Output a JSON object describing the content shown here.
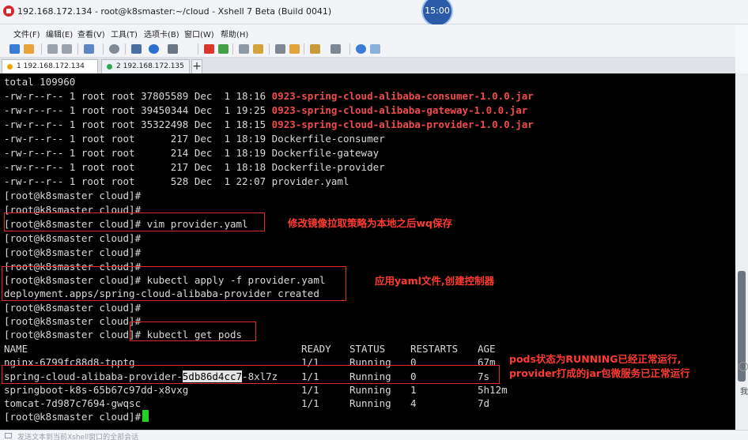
{
  "window": {
    "title": "192.168.172.134 - root@k8smaster:~/cloud - Xshell 7 Beta (Build 0041)",
    "clock": "15:00"
  },
  "menu": [
    "文件(F)",
    "编辑(E)",
    "查看(V)",
    "工具(T)",
    "选项卡(B)",
    "窗口(W)",
    "帮助(H)"
  ],
  "tabs": [
    {
      "label": "1 192.168.172.134",
      "dot_color": "#f0a500"
    },
    {
      "label": "2 192.168.172.135",
      "dot_color": "#2fa84f"
    }
  ],
  "tab_add": "+",
  "terminal": {
    "lines": [
      {
        "text": "total 109960"
      },
      {
        "text": "-rw-r--r-- 1 root root 37805589 Dec  1 18:16 ",
        "jar": "0923-spring-cloud-alibaba-consumer-1.0.0.jar"
      },
      {
        "text": "-rw-r--r-- 1 root root 39450344 Dec  1 19:25 ",
        "jar": "0923-spring-cloud-alibaba-gateway-1.0.0.jar"
      },
      {
        "text": "-rw-r--r-- 1 root root 35322498 Dec  1 18:15 ",
        "jar": "0923-spring-cloud-alibaba-provider-1.0.0.jar"
      },
      {
        "text": "-rw-r--r-- 1 root root      217 Dec  1 18:19 Dockerfile-consumer"
      },
      {
        "text": "-rw-r--r-- 1 root root      214 Dec  1 18:19 Dockerfile-gateway"
      },
      {
        "text": "-rw-r--r-- 1 root root      217 Dec  1 18:18 Dockerfile-provider"
      },
      {
        "text": "-rw-r--r-- 1 root root      528 Dec  1 22:07 provider.yaml"
      },
      {
        "text": "[root@k8smaster cloud]#"
      },
      {
        "text": "[root@k8smaster cloud]#"
      },
      {
        "text": "[root@k8smaster cloud]# vim provider.yaml"
      },
      {
        "text": "[root@k8smaster cloud]#"
      },
      {
        "text": "[root@k8smaster cloud]#"
      },
      {
        "text": "[root@k8smaster cloud]#"
      },
      {
        "text": "[root@k8smaster cloud]# kubectl apply -f provider.yaml"
      },
      {
        "text": "deployment.apps/spring-cloud-alibaba-provider created"
      },
      {
        "text": "[root@k8smaster cloud]#"
      },
      {
        "text": "[root@k8smaster cloud]#"
      },
      {
        "text": "[root@k8smaster cloud]# kubectl get pods"
      }
    ],
    "pods_header": [
      "NAME",
      "READY",
      "STATUS",
      "RESTARTS",
      "AGE"
    ],
    "pods": [
      [
        "nginx-6799fc88d8-tpptg",
        "1/1",
        "Running",
        "0",
        "67m"
      ],
      [
        "spring-cloud-alibaba-provider-5db86d4cc7-8xl7z",
        "1/1",
        "Running",
        "0",
        "7s"
      ],
      [
        "springboot-k8s-65b67c97dd-x8vxg",
        "1/1",
        "Running",
        "1",
        "5h12m"
      ],
      [
        "tomcat-7d987c7694-gwqsc",
        "1/1",
        "Running",
        "4",
        "7d"
      ]
    ],
    "provider_pod": {
      "prefix": "spring-cloud-alibaba-provider-",
      "hash": "5db86d4cc7",
      "suffix": "-8xl7z"
    },
    "final_prompt": "[root@k8smaster cloud]#"
  },
  "annotations": {
    "vim_note": "修改镜像拉取策略为本地之后wq保存",
    "apply_note": "应用yaml文件,创建控制器",
    "pods_note_1": "pods状态为RUNNING已经正常运行,",
    "pods_note_2": "provider打成的jar包微服务已正常运行"
  },
  "side": {
    "glyph": "©",
    "text": "我"
  },
  "status": {
    "text": "发送文本到当前Xshell窗口的全部会话"
  },
  "colors": {
    "jar_red": "#f14c4c",
    "annotation_red": "#ff3b30",
    "cursor_green": "#21d321"
  }
}
